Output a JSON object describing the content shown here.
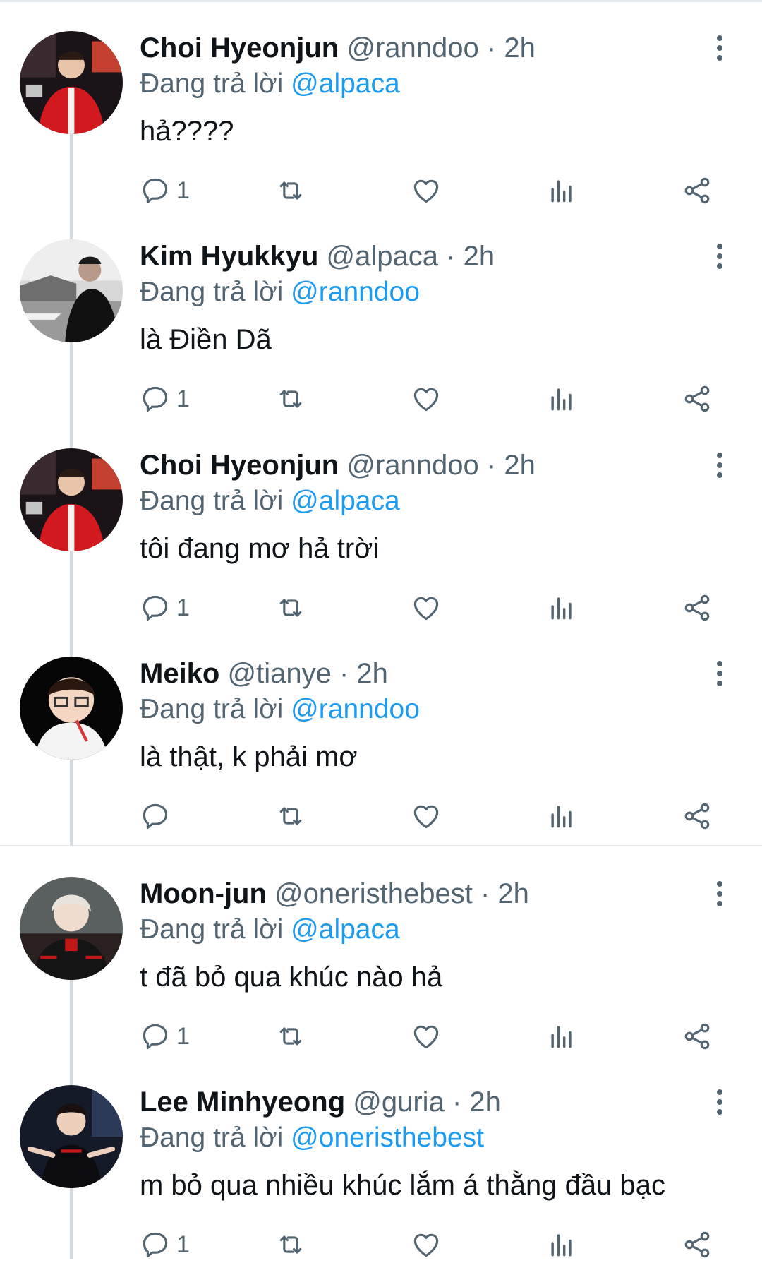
{
  "reply_prefix": "Đang trả lời",
  "separator": "·",
  "tweets": [
    {
      "name": "Choi Hyeonjun",
      "handle": "@ranndoo",
      "time": "2h",
      "reply_to": "@alpaca",
      "text": "hả????",
      "reply_count": "1",
      "avatar": "player in red jacket"
    },
    {
      "name": "Kim Hyukkyu",
      "handle": "@alpaca",
      "time": "2h",
      "reply_to": "@ranndoo",
      "text": "là Điền Dã",
      "reply_count": "1",
      "avatar": "person by lake"
    },
    {
      "name": "Choi Hyeonjun",
      "handle": "@ranndoo",
      "time": "2h",
      "reply_to": "@alpaca",
      "text": "tôi đang mơ hả trời",
      "reply_count": "1",
      "avatar": "player in red jacket"
    },
    {
      "name": "Meiko",
      "handle": "@tianye",
      "time": "2h",
      "reply_to": "@ranndoo",
      "text": "là thật, k phải mơ",
      "reply_count": "",
      "avatar": "player with glasses"
    },
    {
      "name": "Moon-jun",
      "handle": "@oneristhebest",
      "time": "2h",
      "reply_to": "@alpaca",
      "text": "t đã bỏ qua khúc nào hả",
      "reply_count": "1",
      "avatar": "player with white hair"
    },
    {
      "name": "Lee Minhyeong",
      "handle": "@guria",
      "time": "2h",
      "reply_to": "@oneristhebest",
      "text": "m bỏ qua nhiều khúc lắm á thằng đầu bạc",
      "reply_count": "1",
      "avatar": "player pointing"
    }
  ],
  "icons": {
    "reply": "reply-icon",
    "retweet": "retweet-icon",
    "like": "heart-icon",
    "views": "views-icon",
    "share": "share-icon",
    "more": "more-icon"
  },
  "colors": {
    "text": "#0f1419",
    "secondary": "#536471",
    "link": "#1d9bf0",
    "thread_line": "#cfd9de"
  }
}
